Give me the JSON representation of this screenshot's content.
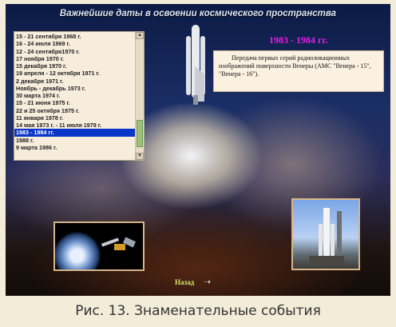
{
  "page_title": "Важнейшие даты в освоении космического пространства",
  "dates_list": [
    "15 - 21 сентября 1968 г.",
    "16 - 24 июля 1969 г.",
    "12 - 24 сентября1970 г.",
    "17 ноября 1970 г.",
    "15 декабря 1970 г.",
    "19 апреля - 12 октября 1971 г.",
    "2 декабря 1971 г.",
    "Ноябрь - декабрь 1973 г.",
    "30 марта 1974 г.",
    "15 - 21 июня 1975 г.",
    "22 и 25 октября 1975 г.",
    "11 января 1978 г.",
    "14 мая 1973 г. - 11 июля 1979 г.",
    "1983 - 1984 гг.",
    "1988 г.",
    "9 марта 1986 г."
  ],
  "selected_index": 13,
  "period_heading": "1983 - 1984 гг.",
  "event_text": "Передача первых серий радиолокационных изображений поверхности Венеры (АМС \"Венера - 15\", \"Венера - 16\").",
  "back_link": "Назад",
  "caption": "Рис. 13.  Знаменательные события",
  "colors": {
    "heading": "#e61ee6",
    "selected": "#0a36c7",
    "back_link": "#d6e86a"
  }
}
